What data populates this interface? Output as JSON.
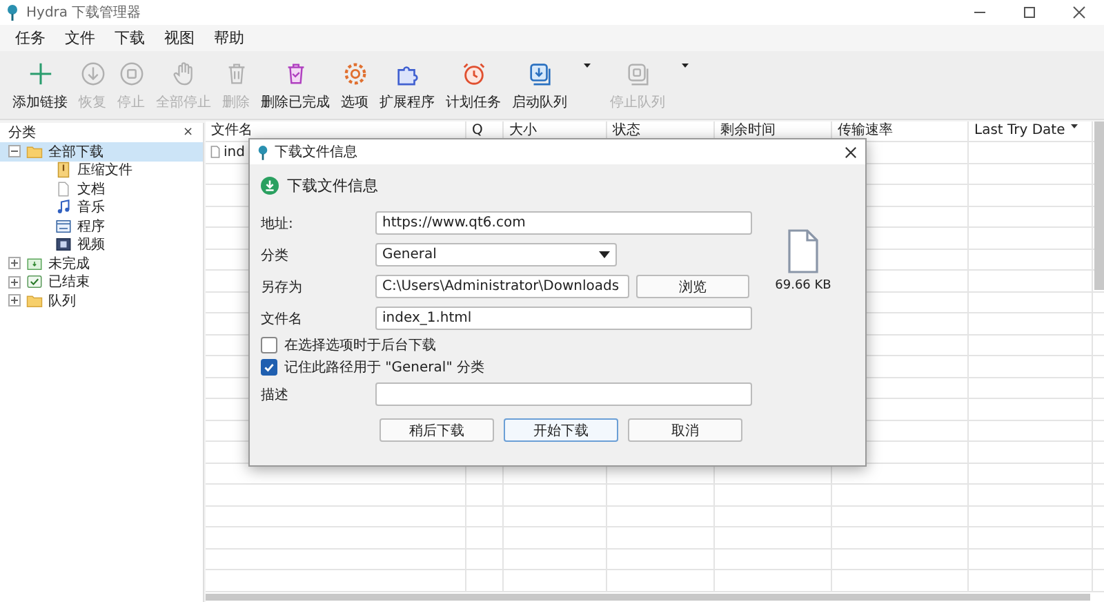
{
  "window": {
    "title": "Hydra 下载管理器"
  },
  "menu": [
    "任务",
    "文件",
    "下载",
    "视图",
    "帮助"
  ],
  "toolbar": [
    {
      "label": "添加链接",
      "disabled": false,
      "dropdown": false
    },
    {
      "label": "恢复",
      "disabled": true,
      "dropdown": false
    },
    {
      "label": "停止",
      "disabled": true,
      "dropdown": false
    },
    {
      "label": "全部停止",
      "disabled": true,
      "dropdown": false
    },
    {
      "label": "删除",
      "disabled": true,
      "dropdown": false
    },
    {
      "label": "删除已完成",
      "disabled": false,
      "dropdown": false
    },
    {
      "label": "选项",
      "disabled": false,
      "dropdown": false
    },
    {
      "label": "扩展程序",
      "disabled": false,
      "dropdown": false
    },
    {
      "label": "计划任务",
      "disabled": false,
      "dropdown": false
    },
    {
      "label": "启动队列",
      "disabled": false,
      "dropdown": true
    },
    {
      "label": "停止队列",
      "disabled": true,
      "dropdown": true
    }
  ],
  "sidebar": {
    "title": "分类",
    "close": "×",
    "tree": [
      {
        "label": "全部下载",
        "expanded": true,
        "selected": true,
        "children": [
          {
            "label": "压缩文件",
            "selected": false
          },
          {
            "label": "文档",
            "selected": false
          },
          {
            "label": "音乐",
            "selected": false
          },
          {
            "label": "程序",
            "selected": false
          },
          {
            "label": "视频",
            "selected": false
          }
        ]
      },
      {
        "label": "未完成",
        "expanded": false,
        "selected": false
      },
      {
        "label": "已结束",
        "expanded": false,
        "selected": false
      },
      {
        "label": "队列",
        "expanded": false,
        "selected": false
      }
    ]
  },
  "table": {
    "columns": [
      {
        "label": "文件名",
        "sorted": false
      },
      {
        "label": "Q",
        "sorted": false
      },
      {
        "label": "大小",
        "sorted": false
      },
      {
        "label": "状态",
        "sorted": false
      },
      {
        "label": "剩余时间",
        "sorted": false
      },
      {
        "label": "传输速率",
        "sorted": false
      },
      {
        "label": "Last Try Date",
        "sorted": true
      }
    ],
    "rows": [
      {
        "file_name": "ind"
      }
    ]
  },
  "dialog": {
    "title": "下载文件信息",
    "heading": "下载文件信息",
    "fields": [
      {
        "kind": "text",
        "label": "地址:",
        "value": "https://www.qt6.com"
      },
      {
        "kind": "select",
        "label": "分类",
        "value": "General"
      },
      {
        "kind": "path",
        "label": "另存为",
        "value": "C:\\Users\\Administrator\\Downloads",
        "button": "浏览"
      },
      {
        "kind": "text",
        "label": "文件名",
        "value": "index_1.html"
      }
    ],
    "file_size": "69.66 KB",
    "options": [
      {
        "label": "在选择选项时于后台下载",
        "checked": false
      },
      {
        "label": "记住此路径用于 \"General\" 分类",
        "checked": true
      }
    ],
    "description": {
      "label": "描述"
    },
    "buttons": [
      {
        "label": "稍后下载",
        "default": false
      },
      {
        "label": "开始下载",
        "default": true
      },
      {
        "label": "取消",
        "default": false
      }
    ]
  }
}
